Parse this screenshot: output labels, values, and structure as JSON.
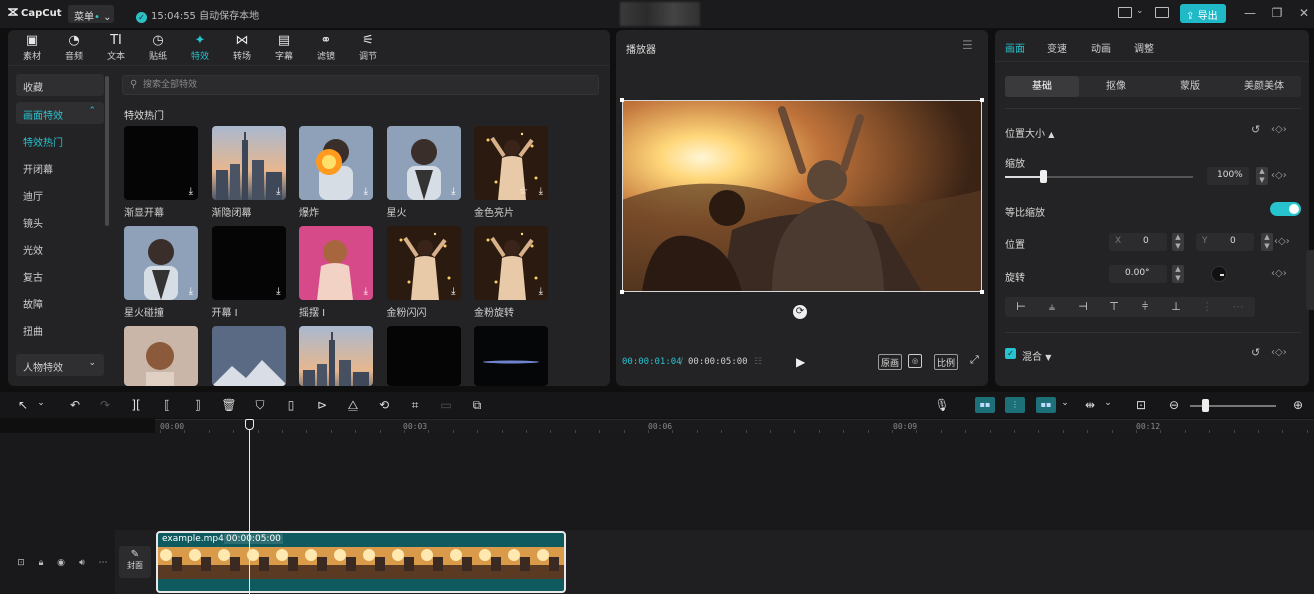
{
  "app": {
    "logo": "CapCut",
    "menu_label": "菜单",
    "menu_indicator": "•",
    "save_status": "15:04:55 自动保存本地",
    "export_label": "导出"
  },
  "tool_tabs": [
    {
      "label": "素材",
      "icon": "media-icon",
      "glyph": "▣"
    },
    {
      "label": "音频",
      "icon": "audio-icon",
      "glyph": "◔"
    },
    {
      "label": "文本",
      "icon": "text-icon",
      "glyph": "TI"
    },
    {
      "label": "贴纸",
      "icon": "sticker-icon",
      "glyph": "◷"
    },
    {
      "label": "特效",
      "icon": "effects-icon",
      "glyph": "✦",
      "active": true
    },
    {
      "label": "转场",
      "icon": "transition-icon",
      "glyph": "⋈"
    },
    {
      "label": "字幕",
      "icon": "caption-icon",
      "glyph": "▤"
    },
    {
      "label": "滤镜",
      "icon": "filter-icon",
      "glyph": "⚭"
    },
    {
      "label": "调节",
      "icon": "adjust-icon",
      "glyph": "⚟"
    }
  ],
  "categories": [
    {
      "label": "收藏",
      "style": "boxed"
    },
    {
      "label": "画面特效",
      "style": "boxed-cyan",
      "expander": "⌃"
    },
    {
      "label": "特效热门",
      "style": "cyan"
    },
    {
      "label": "开闭幕"
    },
    {
      "label": "迪厅"
    },
    {
      "label": "镜头"
    },
    {
      "label": "光效"
    },
    {
      "label": "复古"
    },
    {
      "label": "故障"
    },
    {
      "label": "扭曲"
    },
    {
      "label": "人物特效",
      "style": "boxed",
      "expander": "⌄"
    }
  ],
  "search": {
    "placeholder": "搜索全部特效"
  },
  "effects": {
    "section_title": "特效热门",
    "items": [
      {
        "label": "渐显开幕",
        "thumb": "black"
      },
      {
        "label": "渐隐闭幕",
        "thumb": "city"
      },
      {
        "label": "爆炸",
        "thumb": "portrait-fire"
      },
      {
        "label": "星火",
        "thumb": "portrait"
      },
      {
        "label": "金色亮片",
        "thumb": "dancer",
        "favorite": true
      },
      {
        "label": "星火碰撞",
        "thumb": "portrait"
      },
      {
        "label": "开幕 I",
        "thumb": "black"
      },
      {
        "label": "摇摆 I",
        "thumb": "pink"
      },
      {
        "label": "金粉闪闪",
        "thumb": "dancer"
      },
      {
        "label": "金粉旋转",
        "thumb": "dancer"
      },
      {
        "label": "",
        "thumb": "woman"
      },
      {
        "label": "",
        "thumb": "mountain"
      },
      {
        "label": "",
        "thumb": "city"
      },
      {
        "label": "",
        "thumb": "black"
      },
      {
        "label": "",
        "thumb": "glow"
      }
    ]
  },
  "player": {
    "title": "播放器",
    "current_time": "00:00:01:04",
    "separator": "/",
    "total_time": "00:00:05:00",
    "buttons": {
      "original": "原画",
      "ratio": "比例"
    }
  },
  "props": {
    "tabs": [
      "画面",
      "变速",
      "动画",
      "调整"
    ],
    "subtabs": [
      "基础",
      "抠像",
      "蒙版",
      "美颜美体"
    ],
    "position_size_label": "位置大小",
    "scale_label": "缩放",
    "scale_value": "100%",
    "scale_fraction": 0.2,
    "uniform_scale_label": "等比缩放",
    "position_label": "位置",
    "x_label": "X",
    "x_value": "0",
    "y_label": "Y",
    "y_value": "0",
    "rotation_label": "旋转",
    "rotation_value": "0.00°",
    "blend_label": "混合"
  },
  "timeline": {
    "ticks": [
      "00:00",
      "00:03",
      "00:06",
      "00:09",
      "00:12"
    ],
    "clip_name": "example.mp4",
    "clip_duration": "00:00:05:00",
    "cover_label": "封面"
  },
  "colors": {
    "accent": "#27c3cf",
    "clip": "#0f5a5e",
    "panel": "#232325",
    "background": "#0f0f10"
  }
}
